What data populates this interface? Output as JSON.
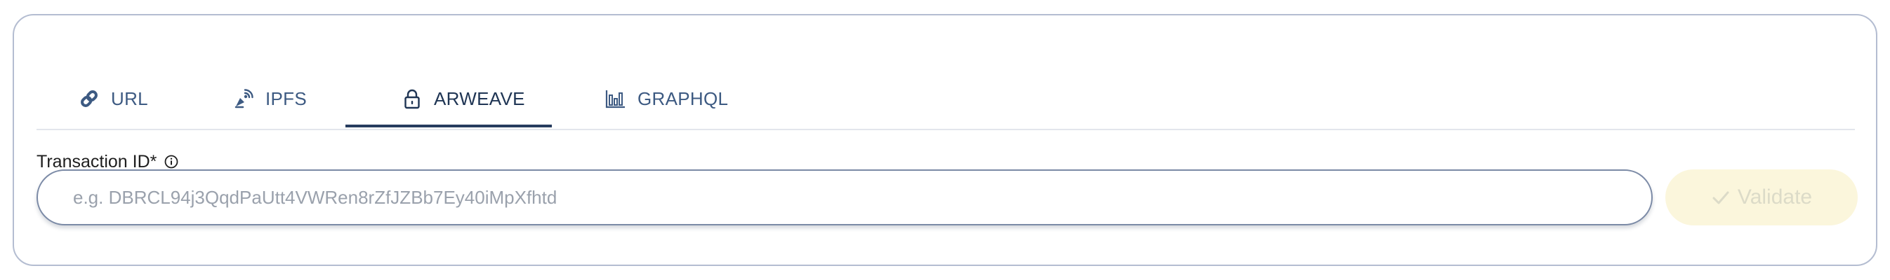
{
  "tabs": [
    {
      "label": "URL",
      "icon": "link-icon",
      "active": false
    },
    {
      "label": "IPFS",
      "icon": "satellite-dish-icon",
      "active": false
    },
    {
      "label": "ARWEAVE",
      "icon": "lock-icon",
      "active": true
    },
    {
      "label": "GRAPHQL",
      "icon": "bar-chart-icon",
      "active": false
    }
  ],
  "field": {
    "label": "Transaction ID*",
    "info_icon": "info-icon",
    "placeholder": "e.g. DBRCL94j3QqdPaUtt4VWRen8rZfJZBb7Ey40iMpXfhtd",
    "value": ""
  },
  "validate_button": {
    "label": "Validate",
    "icon": "check-icon",
    "disabled": true
  },
  "colors": {
    "tab_text": "#3d5a82",
    "active_underline": "#263c5e",
    "card_border": "#b4bdd1",
    "input_border": "#7b8aa6",
    "button_bg": "#fbf6dc",
    "button_text": "#dcdbc8"
  }
}
